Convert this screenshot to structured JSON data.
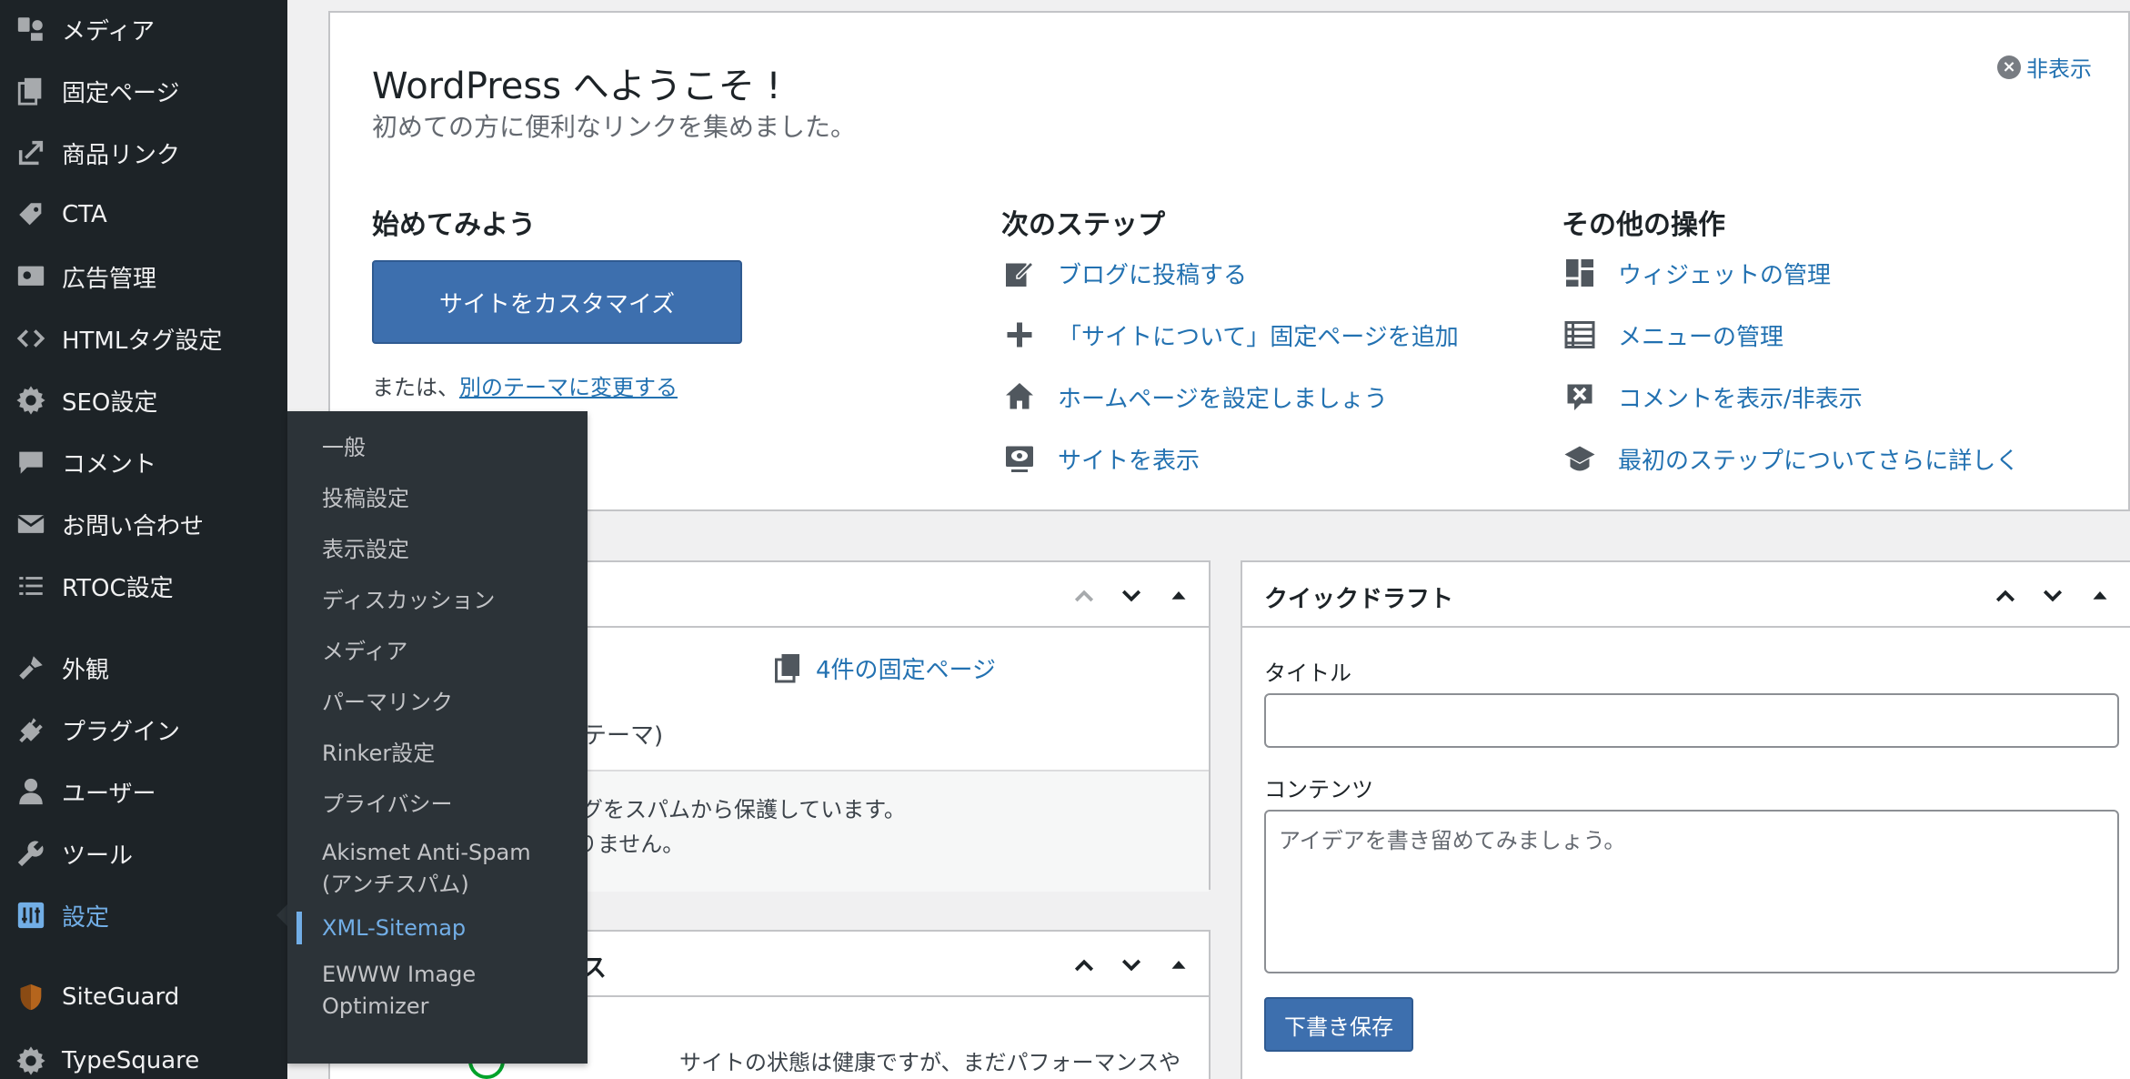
{
  "sidebar": {
    "items": [
      {
        "label": "メディア",
        "icon": "media-icon"
      },
      {
        "label": "固定ページ",
        "icon": "pages-icon"
      },
      {
        "label": "商品リンク",
        "icon": "external-link-icon"
      },
      {
        "label": "CTA",
        "icon": "tag-icon"
      },
      {
        "label": "広告管理",
        "icon": "ad-icon"
      },
      {
        "label": "HTMLタグ設定",
        "icon": "code-icon"
      },
      {
        "label": "SEO設定",
        "icon": "gear-icon"
      },
      {
        "label": "コメント",
        "icon": "comment-icon"
      },
      {
        "label": "お問い合わせ",
        "icon": "mail-icon"
      },
      {
        "label": "RTOC設定",
        "icon": "list-icon"
      },
      {
        "label": "外観",
        "icon": "brush-icon"
      },
      {
        "label": "プラグイン",
        "icon": "plugin-icon"
      },
      {
        "label": "ユーザー",
        "icon": "user-icon"
      },
      {
        "label": "ツール",
        "icon": "wrench-icon"
      },
      {
        "label": "設定",
        "icon": "settings-icon"
      },
      {
        "label": "SiteGuard",
        "icon": "shield-icon"
      },
      {
        "label": "TypeSquare",
        "icon": "gear-icon"
      }
    ],
    "current": "設定"
  },
  "submenu": {
    "items": [
      "一般",
      "投稿設定",
      "表示設定",
      "ディスカッション",
      "メディア",
      "パーマリンク",
      "Rinker設定",
      "プライバシー",
      "Akismet Anti-Spam (アンチスパム)",
      "XML-Sitemap",
      "EWWW Image Optimizer"
    ],
    "current": "XML-Sitemap"
  },
  "welcome": {
    "title": "WordPress へようこそ !",
    "subtitle": "初めての方に便利なリンクを集めました。",
    "dismiss": "非表示",
    "col1": {
      "heading": "始めてみよう",
      "button": "サイトをカスタマイズ",
      "or_prefix": "または、",
      "or_link": "別のテーマに変更する"
    },
    "col2": {
      "heading": "次のステップ",
      "links": [
        "ブログに投稿する",
        "「サイトについて」固定ページを追加",
        "ホームページを設定しましょう",
        "サイトを表示"
      ]
    },
    "col3": {
      "heading": "その他の操作",
      "links": [
        "ウィジェットの管理",
        "メニューの管理",
        "コメントを表示/非表示",
        "最初のステップについてさらに詳しく"
      ]
    }
  },
  "glance": {
    "pages_link": "4件の固定ページ",
    "theme_fragment": "テーマ)",
    "akismet_line1": "ログをスパムから保護しています。",
    "akismet_line2": "りません。"
  },
  "health": {
    "title_fragment": "ス",
    "text_fragment": "サイトの状態は健康ですが、まだパフォーマンスや"
  },
  "quick_draft": {
    "title": "クイックドラフト",
    "title_label": "タイトル",
    "title_value": "",
    "content_label": "コンテンツ",
    "content_placeholder": "アイデアを書き留めてみましょう。",
    "save_button": "下書き保存"
  },
  "colors": {
    "sidebar_bg": "#1d2327",
    "submenu_bg": "#2c3338",
    "accent": "#72aee6",
    "link": "#2271b1",
    "button": "#3d6fae"
  }
}
